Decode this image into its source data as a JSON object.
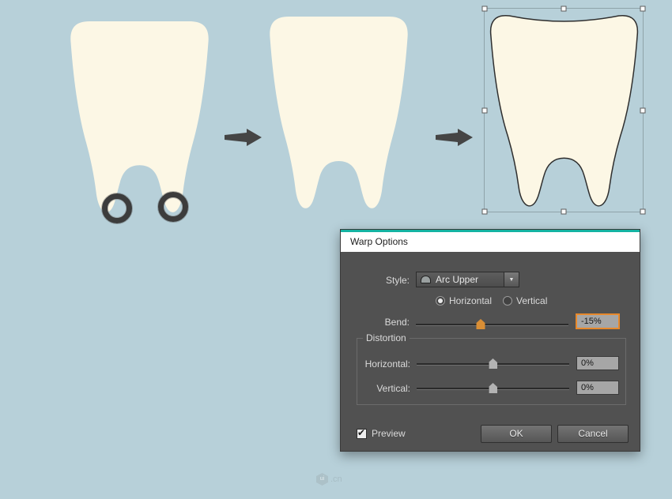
{
  "colors": {
    "background": "#b7d0d9",
    "tooth_fill": "#fcf7e5",
    "tooth_outline": "#2f2f2f",
    "arrow": "#454545",
    "dialog_body": "#515151",
    "dialog_titlebar": "#ffffff",
    "accent_teal": "#14b3a2",
    "highlight_orange": "#e8892c",
    "ring": "#3c3c3c"
  },
  "dialog": {
    "title": "Warp Options",
    "style_label": "Style:",
    "style_value": "Arc Upper",
    "orientation": {
      "horizontal_label": "Horizontal",
      "vertical_label": "Vertical",
      "selected": "Horizontal"
    },
    "bend": {
      "label": "Bend:",
      "value": "-15%",
      "slider_percent": 42.5
    },
    "distortion": {
      "title": "Distortion",
      "horizontal": {
        "label": "Horizontal:",
        "value": "0%",
        "slider_percent": 50
      },
      "vertical": {
        "label": "Vertical:",
        "value": "0%",
        "slider_percent": 50
      }
    },
    "preview_label": "Preview",
    "buttons": {
      "ok": "OK",
      "cancel": "Cancel"
    }
  },
  "watermark": {
    "logo": "ui",
    "suffix": ".cn"
  }
}
